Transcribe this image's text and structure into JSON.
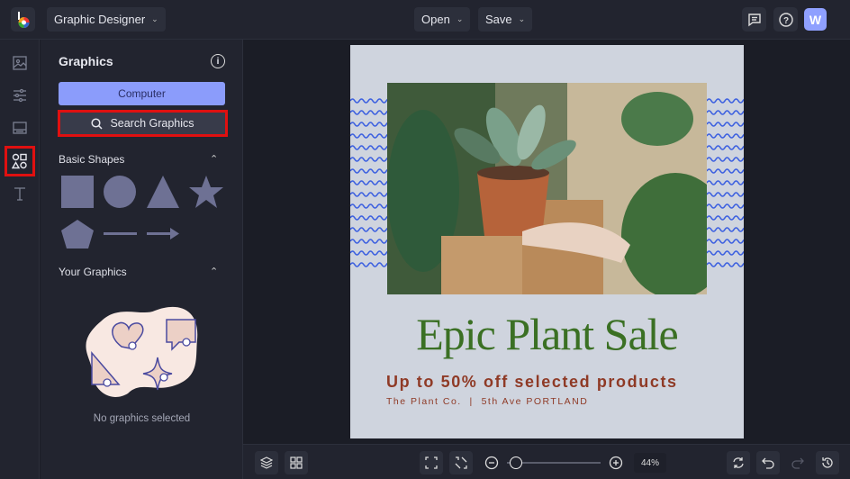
{
  "topbar": {
    "app_menu": "Graphic Designer",
    "open": "Open",
    "save": "Save",
    "avatar_initial": "W"
  },
  "rail": {
    "items": [
      "image-icon",
      "sliders-icon",
      "background-icon",
      "shapes-icon",
      "text-icon"
    ],
    "selected": "shapes-icon"
  },
  "panel": {
    "title": "Graphics",
    "computer_button": "Computer",
    "search_button": "Search Graphics",
    "basic_shapes": "Basic Shapes",
    "your_graphics": "Your Graphics",
    "empty_text": "No graphics selected"
  },
  "design": {
    "title": "Epic Plant Sale",
    "subtitle": "Up to 50% off selected products",
    "tagline": "The Plant Co.  |  5th Ave PORTLAND"
  },
  "bottombar": {
    "zoom": "44%"
  },
  "colors": {
    "accent": "#8b9cfb",
    "title_green": "#3b7024",
    "subtitle_red": "#8f3a26",
    "wave_blue": "#3b5fe0",
    "highlight": "#e01010"
  }
}
